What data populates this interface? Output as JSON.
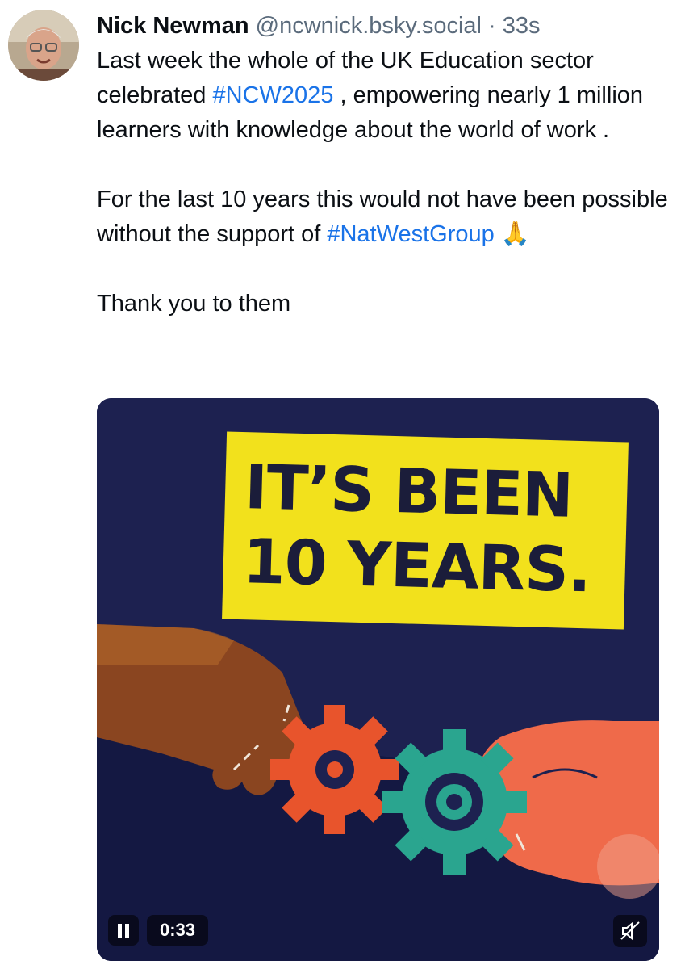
{
  "post": {
    "author_name": "Nick Newman",
    "author_handle": "@ncwnick.bsky.social",
    "separator": "·",
    "timestamp": "33s",
    "text": {
      "p1_a": "Last week the whole of the UK Education sector celebrated ",
      "hashtag1": "#NCW2025",
      "p1_b": " , empowering nearly 1 million learners with knowledge about the world of work .",
      "p2_a": "For the last 10 years this would not have been possible without the support of ",
      "hashtag2": "#NatWestGroup",
      "emoji": "🙏",
      "p3": "Thank you to them"
    }
  },
  "media": {
    "headline_line1": "IT’S BEEN",
    "headline_line2": "10 YEARS.",
    "video_time": "0:33",
    "icons": {
      "play_state": "pause-icon",
      "sound": "muted-speaker-icon"
    }
  },
  "colors": {
    "link": "#1a73e8",
    "media_bg": "#1a1f47",
    "headline_bg": "#f2e11c",
    "gear_left": "#e8542c",
    "gear_right": "#2aa58f",
    "hand_right": "#ef6a4a",
    "hand_left": "#8a4520"
  }
}
